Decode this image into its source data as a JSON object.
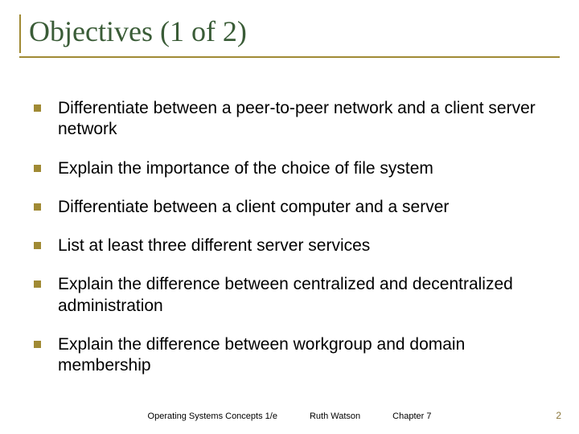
{
  "title": "Objectives (1 of 2)",
  "bullets": [
    "Differentiate between a peer-to-peer network and a client server network",
    "Explain the importance of the choice of file system",
    "Differentiate between a client computer and a server",
    "List at least three different server services",
    "Explain the difference between centralized and decentralized administration",
    "Explain the difference between workgroup and domain membership"
  ],
  "footer": {
    "left": "Operating Systems Concepts 1/e",
    "center": "Ruth Watson",
    "right": "Chapter 7"
  },
  "page_number": "2"
}
